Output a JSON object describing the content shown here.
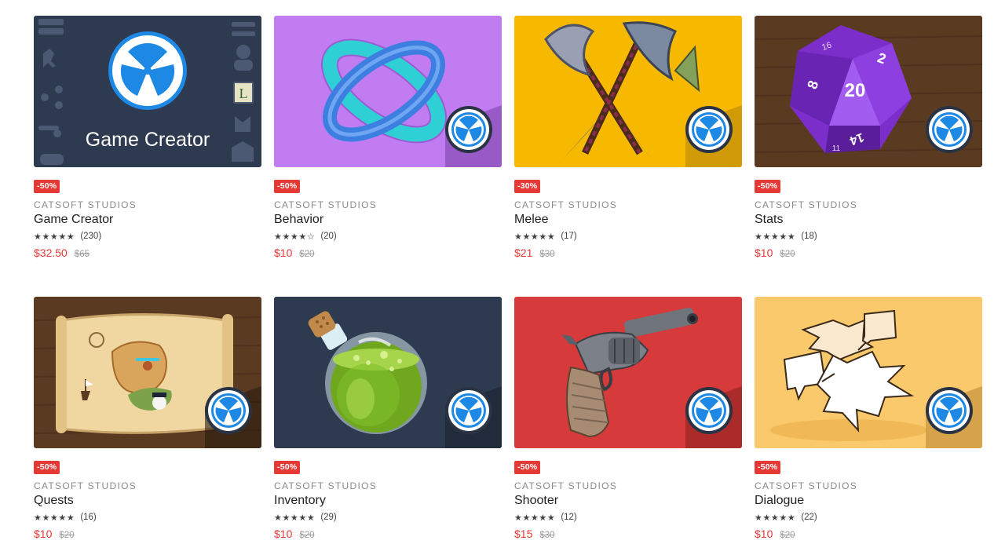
{
  "colors": {
    "sale": "#e53935",
    "publisher": "#8a8a8a",
    "title": "#212121"
  },
  "products": [
    {
      "id": "game-creator",
      "discount": "-50%",
      "publisher": "CATSOFT STUDIOS",
      "title": "Game Creator",
      "stars": "★★★★★",
      "rating_count": "(230)",
      "price": "$32.50",
      "old_price": "$65",
      "image_label": "Game Creator",
      "bg": "#2e3a4f"
    },
    {
      "id": "behavior",
      "discount": "-50%",
      "publisher": "CATSOFT STUDIOS",
      "title": "Behavior",
      "stars": "★★★★☆",
      "rating_count": "(20)",
      "price": "$10",
      "old_price": "$20",
      "bg": "#c27cf2"
    },
    {
      "id": "melee",
      "discount": "-30%",
      "publisher": "CATSOFT STUDIOS",
      "title": "Melee",
      "stars": "★★★★★",
      "rating_count": "(17)",
      "price": "$21",
      "old_price": "$30",
      "bg": "#f7b900"
    },
    {
      "id": "stats",
      "discount": "-50%",
      "publisher": "CATSOFT STUDIOS",
      "title": "Stats",
      "stars": "★★★★★",
      "rating_count": "(18)",
      "price": "$10",
      "old_price": "$20",
      "bg": "#5b3a22",
      "dice_numbers": [
        "20",
        "2",
        "8",
        "16",
        "14",
        "11"
      ]
    },
    {
      "id": "quests",
      "discount": "-50%",
      "publisher": "CATSOFT STUDIOS",
      "title": "Quests",
      "stars": "★★★★★",
      "rating_count": "(16)",
      "price": "$10",
      "old_price": "$20",
      "bg": "#5b3a22"
    },
    {
      "id": "inventory",
      "discount": "-50%",
      "publisher": "CATSOFT STUDIOS",
      "title": "Inventory",
      "stars": "★★★★★",
      "rating_count": "(29)",
      "price": "$10",
      "old_price": "$20",
      "bg": "#2e3a4f"
    },
    {
      "id": "shooter",
      "discount": "-50%",
      "publisher": "CATSOFT STUDIOS",
      "title": "Shooter",
      "stars": "★★★★★",
      "rating_count": "(12)",
      "price": "$15",
      "old_price": "$30",
      "bg": "#d63a3a"
    },
    {
      "id": "dialogue",
      "discount": "-50%",
      "publisher": "CATSOFT STUDIOS",
      "title": "Dialogue",
      "stars": "★★★★★",
      "rating_count": "(22)",
      "price": "$10",
      "old_price": "$20",
      "bg": "#f9c96b"
    }
  ]
}
